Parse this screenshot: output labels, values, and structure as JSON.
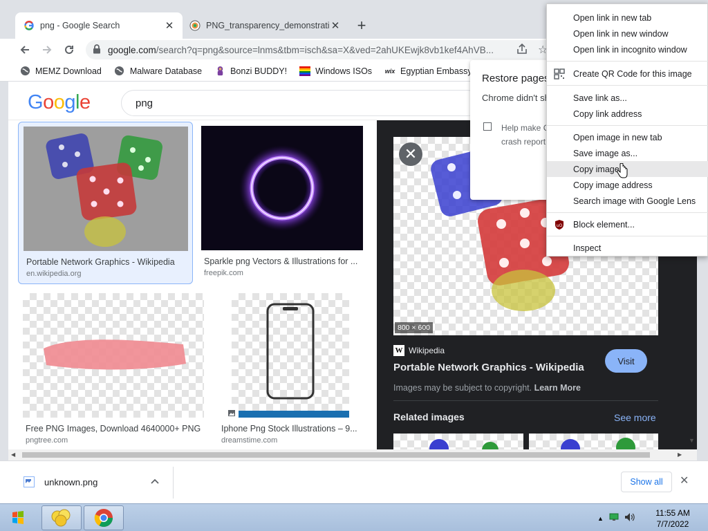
{
  "tabs": [
    {
      "title": "png - Google Search",
      "active": true
    },
    {
      "title": "PNG_transparency_demonstration",
      "active": false
    }
  ],
  "omnibox": {
    "host": "google.com",
    "path": "/search?q=png&source=lnms&tbm=isch&sa=X&ved=2ahUKEwjk8vb1kef4AhVB..."
  },
  "bookmarks": [
    {
      "label": "MEMZ Download",
      "icon": "globe-icon"
    },
    {
      "label": "Malware Database",
      "icon": "globe-icon"
    },
    {
      "label": "Bonzi BUDDY!",
      "icon": "bonzi-icon"
    },
    {
      "label": "Windows ISOs",
      "icon": "windows-flag-icon"
    },
    {
      "label": "Egyptian Embassy",
      "icon": "wix-icon"
    }
  ],
  "google": {
    "query": "png"
  },
  "results": [
    {
      "title": "Portable Network Graphics - Wikipedia",
      "source": "en.wikipedia.org"
    },
    {
      "title": "Sparkle png Vectors & Illustrations for ...",
      "source": "freepik.com"
    },
    {
      "title": "Free PNG Images, Download 4640000+ PNG...",
      "source": "pngtree.com"
    },
    {
      "title": "Iphone Png Stock Illustrations – 9...",
      "source": "dreamstime.com"
    }
  ],
  "preview": {
    "dimensions": "800 × 600",
    "source": "Wikipedia",
    "title": "Portable Network Graphics - Wikipedia",
    "visit_label": "Visit",
    "copyright_text": "Images may be subject to copyright.",
    "learn_more": "Learn More",
    "related_label": "Related images",
    "see_more": "See more"
  },
  "restore_popup": {
    "title": "Restore pages",
    "body": "Chrome didn't sh",
    "checkbox_line1": "Help make C",
    "checkbox_line2": "crash report"
  },
  "context_menu": {
    "groups": [
      [
        "Open link in new tab",
        "Open link in new window",
        "Open link in incognito window"
      ],
      [
        "Create QR Code for this image"
      ],
      [
        "Save link as...",
        "Copy link address"
      ],
      [
        "Open image in new tab",
        "Save image as...",
        "Copy image",
        "Copy image address",
        "Search image with Google Lens"
      ],
      [
        "Block element..."
      ],
      [
        "Inspect"
      ]
    ],
    "highlighted": "Copy image"
  },
  "download": {
    "filename": "unknown.png",
    "show_all": "Show all"
  },
  "taskbar": {
    "time": "11:55 AM",
    "date": "7/7/2022"
  },
  "colors": {
    "google_blue": "#4285f4",
    "google_red": "#ea4335",
    "google_yellow": "#fbbc05",
    "google_green": "#34a853",
    "preview_bg": "#202124",
    "visit_button": "#8ab4f8"
  }
}
